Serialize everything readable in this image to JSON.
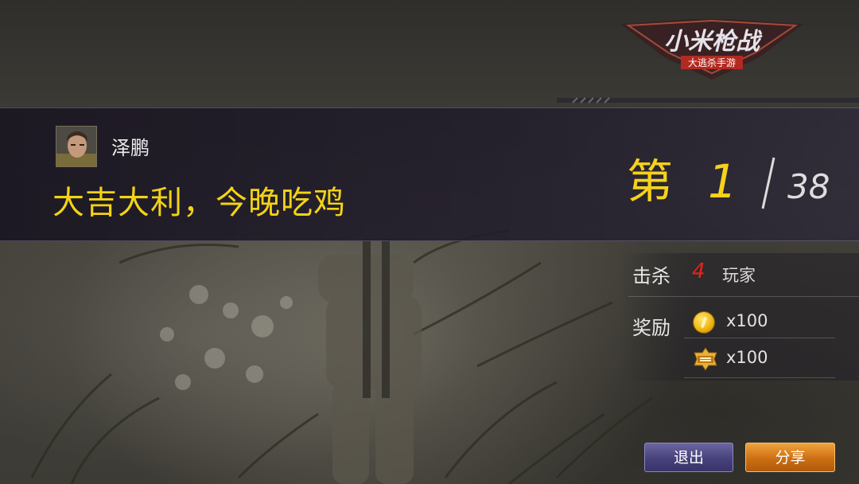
{
  "logo": {
    "title": "小米枪战",
    "subtitle": "大逃杀手游",
    "icon": "game-logo"
  },
  "player": {
    "name": "泽鹏",
    "avatar_icon": "soldier-avatar"
  },
  "result": {
    "headline": "大吉大利，今晚吃鸡",
    "rank_prefix": "第",
    "rank": "1",
    "total": "38"
  },
  "stats": {
    "kill_label": "击杀",
    "kill_count": "4",
    "kill_unit": "玩家",
    "reward_label": "奖励",
    "rewards": [
      {
        "icon": "gold-coin-icon",
        "amount": "x100"
      },
      {
        "icon": "experience-badge-icon",
        "amount": "x100"
      }
    ]
  },
  "buttons": {
    "exit": "退出",
    "share": "分享"
  },
  "colors": {
    "headline": "#f3d316",
    "rank": "#f6d21b",
    "kill_count": "#e8221b",
    "exit_button": "#47427a",
    "share_button": "#cc6f14"
  }
}
